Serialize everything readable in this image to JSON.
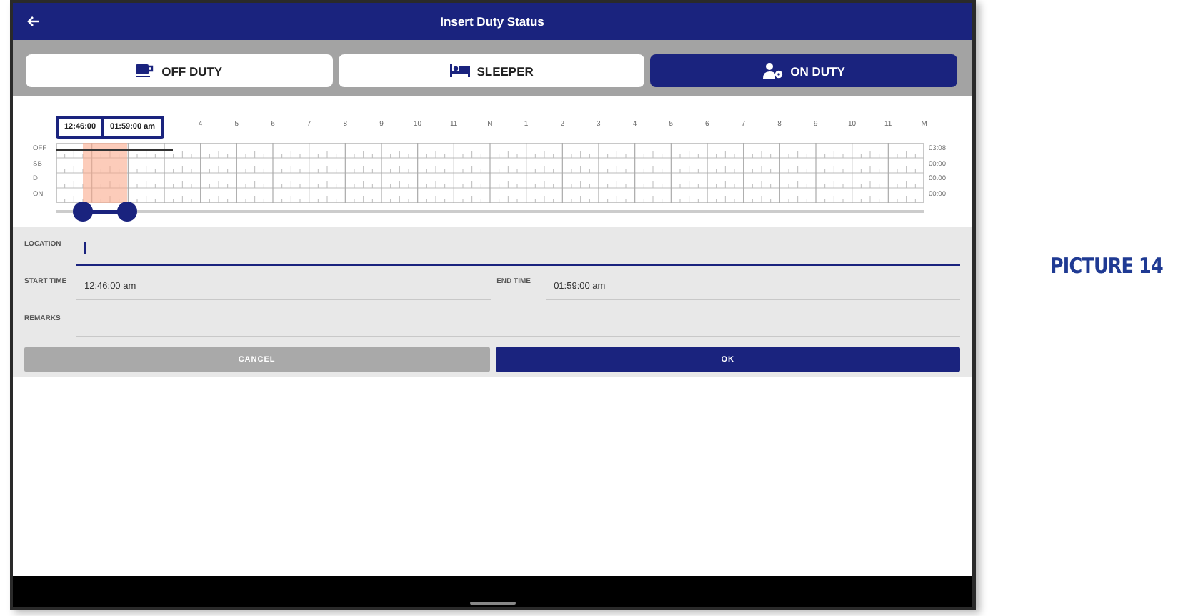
{
  "window": {
    "title": "Insert Duty Status"
  },
  "status_tabs": [
    {
      "label": "OFF DUTY",
      "kind": "off",
      "selected": false
    },
    {
      "label": "SLEEPER",
      "kind": "sleeper",
      "selected": false
    },
    {
      "label": "ON DUTY",
      "kind": "on",
      "selected": true
    }
  ],
  "graph": {
    "hour_labels": [
      "4",
      "5",
      "6",
      "7",
      "8",
      "9",
      "10",
      "11",
      "N",
      "1",
      "2",
      "3",
      "4",
      "5",
      "6",
      "7",
      "8",
      "9",
      "10",
      "11",
      "M"
    ],
    "row_labels": [
      "OFF",
      "SB",
      "D",
      "ON"
    ],
    "totals": [
      "03:08",
      "00:00",
      "00:00",
      "00:00"
    ],
    "tooltip": {
      "start": "12:46:00",
      "end": "01:59:00 am"
    },
    "range": [
      {
        "level": 0.031
      },
      {
        "level": 0.082
      }
    ]
  },
  "form": {
    "location": {
      "label": "LOCATION"
    },
    "start_time": {
      "label": "START TIME",
      "value": "12:46:00 am"
    },
    "end_time": {
      "label": "END TIME",
      "value": "01:59:00 am"
    },
    "remarks": {
      "label": "REMARKS"
    }
  },
  "buttons": [
    {
      "label": "CANCEL",
      "kind": "secondary"
    },
    {
      "label": "OK",
      "kind": "primary"
    }
  ],
  "caption": "PICTURE 14"
}
